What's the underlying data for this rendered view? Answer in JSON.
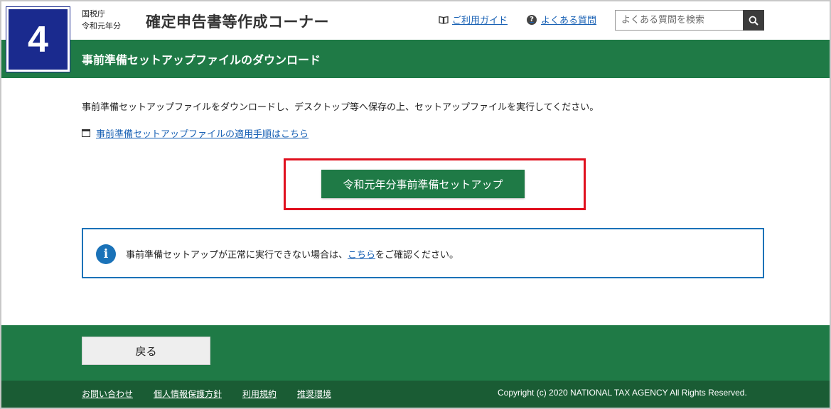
{
  "header": {
    "step_number": "4",
    "agency": "国税庁",
    "year": "令和元年分",
    "app_title": "確定申告書等作成コーナー",
    "guide_link": "ご利用ガイド",
    "faq_link": "よくある質問",
    "search_placeholder": "よくある質問を検索",
    "icons": {
      "guide": "book-icon",
      "faq": "question-circle-icon",
      "search": "search-icon"
    }
  },
  "page": {
    "title": "事前準備セットアップファイルのダウンロード",
    "intro": "事前準備セットアップファイルをダウンロードし、デスクトップ等へ保存の上、セットアップファイルを実行してください。",
    "procedure_link": "事前準備セットアップファイルの適用手順はこちら",
    "setup_button": "令和元年分事前準備セットアップ",
    "info_prefix": "事前準備セットアップが正常に実行できない場合は、",
    "info_link": "こちら",
    "info_suffix": "をご確認ください。"
  },
  "footer": {
    "back_button": "戻る",
    "links": [
      "お問い合わせ",
      "個人情報保護方針",
      "利用規約",
      "推奨環境"
    ],
    "copyright": "Copyright (c) 2020 NATIONAL TAX AGENCY All Rights Reserved."
  },
  "colors": {
    "brand_green": "#1f7a46",
    "dark_green": "#1a5c34",
    "badge_blue": "#1a2a8e",
    "highlight_red": "#e0101e",
    "info_blue": "#1a72b8",
    "link_blue": "#1a62b5"
  }
}
